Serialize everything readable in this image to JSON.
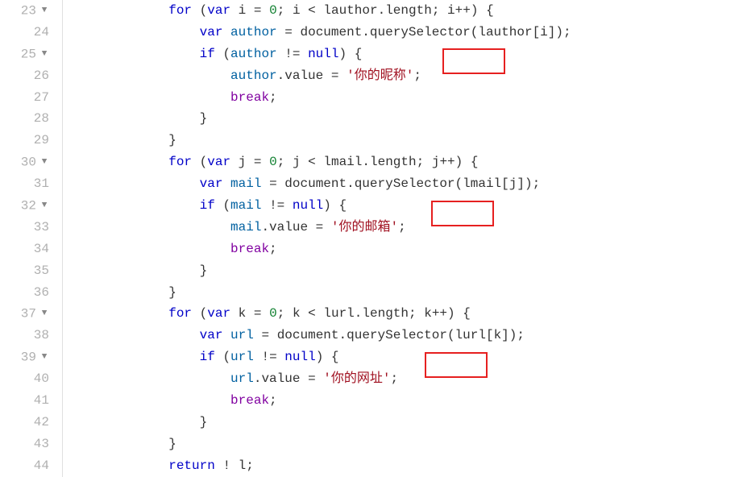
{
  "gutter": [
    {
      "n": "23",
      "f": true
    },
    {
      "n": "24",
      "f": false
    },
    {
      "n": "25",
      "f": true
    },
    {
      "n": "26",
      "f": false
    },
    {
      "n": "27",
      "f": false
    },
    {
      "n": "28",
      "f": false
    },
    {
      "n": "29",
      "f": false
    },
    {
      "n": "30",
      "f": true
    },
    {
      "n": "31",
      "f": false
    },
    {
      "n": "32",
      "f": true
    },
    {
      "n": "33",
      "f": false
    },
    {
      "n": "34",
      "f": false
    },
    {
      "n": "35",
      "f": false
    },
    {
      "n": "36",
      "f": false
    },
    {
      "n": "37",
      "f": true
    },
    {
      "n": "38",
      "f": false
    },
    {
      "n": "39",
      "f": true
    },
    {
      "n": "40",
      "f": false
    },
    {
      "n": "41",
      "f": false
    },
    {
      "n": "42",
      "f": false
    },
    {
      "n": "43",
      "f": false
    },
    {
      "n": "44",
      "f": false
    }
  ],
  "tokens": {
    "for": "for",
    "var": "var",
    "if": "if",
    "return": "return",
    "break": "break",
    "null": "null",
    "document": "document",
    "querySelector": "querySelector",
    "lauthor": "lauthor",
    "lmail": "lmail",
    "lurl": "lurl",
    "length": "length",
    "value": "value",
    "author": "author",
    "mail": "mail",
    "url": "url",
    "i": "i",
    "j": "j",
    "k": "k",
    "l": "l",
    "zero": "0"
  },
  "strings": {
    "nickname": "你的昵称",
    "email": "你的邮箱",
    "website": "你的网址"
  }
}
